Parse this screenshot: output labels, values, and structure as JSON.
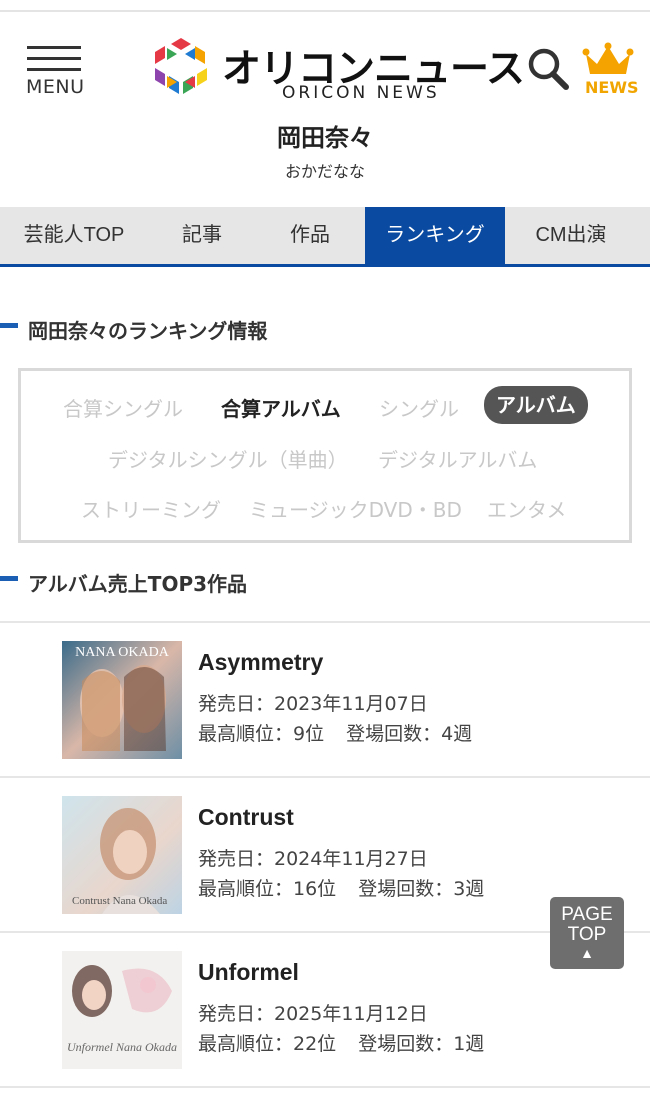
{
  "header": {
    "menu_label": "MENU",
    "logo_jp": "オリコンニュース",
    "logo_en": "ORICON NEWS",
    "news_label": "NEWS",
    "logo_colors": [
      "#e63946",
      "#f4a300",
      "#f7d21b",
      "#3aa655",
      "#1f7bd1",
      "#8e44ad"
    ]
  },
  "artist": {
    "name": "岡田奈々",
    "kana": "おかだなな"
  },
  "tabs": [
    {
      "label": "芸能人TOP",
      "active": false
    },
    {
      "label": "記事",
      "active": false
    },
    {
      "label": "作品",
      "active": false
    },
    {
      "label": "ランキング",
      "active": true
    },
    {
      "label": "CM出演",
      "active": false
    }
  ],
  "ranking_section": {
    "title": "岡田奈々のランキング情報",
    "filters": [
      {
        "label": "合算シングル",
        "state": "disabled"
      },
      {
        "label": "合算アルバム",
        "state": "available"
      },
      {
        "label": "シングル",
        "state": "disabled"
      },
      {
        "label": "アルバム",
        "state": "selected"
      },
      {
        "label": "デジタルシングル（単曲）",
        "state": "disabled"
      },
      {
        "label": "デジタルアルバム",
        "state": "disabled"
      },
      {
        "label": "ストリーミング",
        "state": "disabled"
      },
      {
        "label": "ミュージックDVD・BD",
        "state": "disabled"
      },
      {
        "label": "エンタメ",
        "state": "disabled"
      }
    ]
  },
  "albums_section": {
    "title": "アルバム売上TOP3作品",
    "items": [
      {
        "title": "Asymmetry",
        "release": "発売日：2023年11月07日",
        "peak": "最高順位：9位",
        "weeks": "登場回数：4週",
        "cover_text": "NANA OKADA"
      },
      {
        "title": "Contrust",
        "release": "発売日：2024年11月27日",
        "peak": "最高順位：16位",
        "weeks": "登場回数：3週",
        "cover_text": "Contrust Nana Okada"
      },
      {
        "title": "Unformel",
        "release": "発売日：2025年11月12日",
        "peak": "最高順位：22位",
        "weeks": "登場回数：1週",
        "cover_text": "Unformel Nana Okada"
      }
    ]
  },
  "page_top": {
    "line1": "PAGE",
    "line2": "TOP",
    "arrow": "▲"
  }
}
